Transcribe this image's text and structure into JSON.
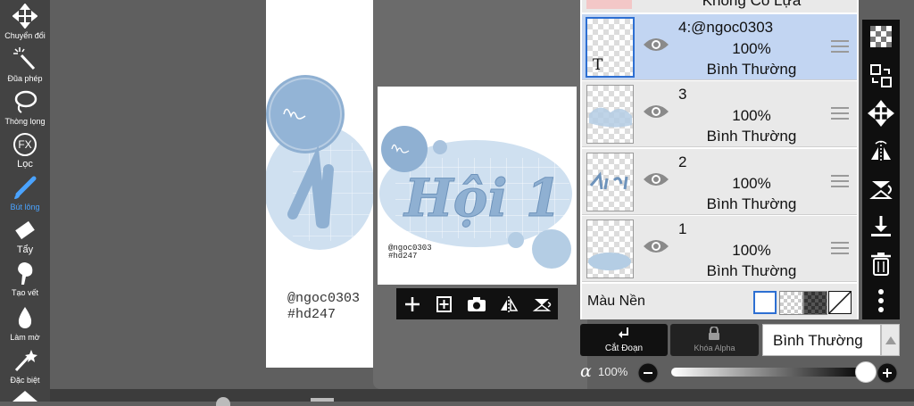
{
  "toolbar": {
    "tools": [
      {
        "label": "Chuyển đổi",
        "icon": "move-icon"
      },
      {
        "label": "Đũa phép",
        "icon": "magic-wand-icon"
      },
      {
        "label": "Thòng lọng",
        "icon": "lasso-icon"
      },
      {
        "label": "Lọc",
        "icon": "fx-filter-icon",
        "icon_text": "FX"
      },
      {
        "label": "Bút lông",
        "icon": "brush-icon",
        "active": true
      },
      {
        "label": "Tẩy",
        "icon": "eraser-icon"
      },
      {
        "label": "Tạo vết",
        "icon": "smudge-icon"
      },
      {
        "label": "Làm mờ",
        "icon": "blur-drop-icon"
      },
      {
        "label": "Đặc biệt",
        "icon": "special-wand-icon"
      }
    ]
  },
  "canvas": {
    "watermark_line1": "@ngoc0303",
    "watermark_line2": "#hd247",
    "artwork_text": "Hội 1"
  },
  "preview": {
    "watermark_line1": "@ngoc0303",
    "watermark_line2": "#hd247",
    "buttons": [
      "add-layer-icon",
      "add-copy-icon",
      "camera-icon",
      "flip-icon",
      "transform-icon"
    ]
  },
  "layers_panel": {
    "top_hint": "Không Có Lựa Chọn",
    "layers": [
      {
        "name": "4:@ngoc0303",
        "opacity": "100%",
        "blend": "Bình Thường",
        "selected": true,
        "text_layer": true,
        "text_mark": "T"
      },
      {
        "name": "3",
        "opacity": "100%",
        "blend": "Bình Thường",
        "selected": false
      },
      {
        "name": "2",
        "opacity": "100%",
        "blend": "Bình Thường",
        "selected": false
      },
      {
        "name": "1",
        "opacity": "100%",
        "blend": "Bình Thường",
        "selected": false
      }
    ],
    "background_label": "Màu Nền"
  },
  "bottom_controls": {
    "clip_label": "Cắt Đoạn",
    "alpha_lock_label": "Khóa Alpha",
    "blend_mode": "Bình Thường",
    "alpha_symbol": "α",
    "opacity_value": "100%",
    "opacity_level": 1.0
  },
  "colors": {
    "accent": "#4aa3ff",
    "selected_layer": "#c2d5f2",
    "artwork_blue": "#8fb0d2"
  }
}
